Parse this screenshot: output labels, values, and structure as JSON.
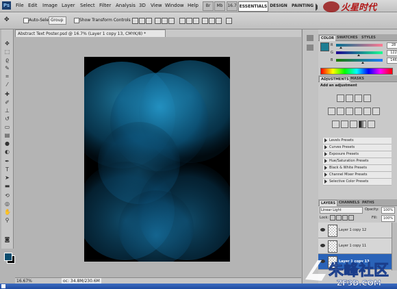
{
  "app": {
    "logo": "Ps",
    "menu": [
      "File",
      "Edit",
      "Image",
      "Layer",
      "Select",
      "Filter",
      "Analysis",
      "3D",
      "View",
      "Window",
      "Help"
    ],
    "zoom": "16.7",
    "workspaces": [
      "ESSENTIALS",
      "DESIGN",
      "PAINTING"
    ],
    "watermark_top": "火星时代"
  },
  "options": {
    "auto_select_label": "Auto-Select:",
    "auto_select_value": "Group",
    "show_transform_label": "Show Transform Controls"
  },
  "document": {
    "tab_title": "Abstract Text Poster.psd @ 16.7% (Layer 1 copy 13, CMYK/8) *"
  },
  "status": {
    "zoom": "16.67%",
    "doc_size": "oc: 34.8M/230.6M"
  },
  "color_panel": {
    "tabs": [
      "COLOR",
      "SWATCHES",
      "STYLES"
    ],
    "channels": [
      {
        "label": "R",
        "value": "28",
        "frac": 0.11
      },
      {
        "label": "G",
        "value": "122",
        "frac": 0.48
      },
      {
        "label": "B",
        "value": "146",
        "frac": 0.57
      }
    ]
  },
  "adjustments_panel": {
    "tabs": [
      "ADJUSTMENTS",
      "MASKS"
    ],
    "heading": "Add an adjustment",
    "presets": [
      "Levels Presets",
      "Curves Presets",
      "Exposure Presets",
      "Hue/Saturation Presets",
      "Black & White Presets",
      "Channel Mixer Presets",
      "Selective Color Presets"
    ]
  },
  "layers_panel": {
    "tabs": [
      "LAYERS",
      "CHANNELS",
      "PATHS"
    ],
    "blend_mode": "Linear Light",
    "opacity_label": "Opacity:",
    "opacity": "100%",
    "lock_label": "Lock:",
    "fill_label": "Fill:",
    "fill": "100%",
    "layers": [
      {
        "name": "Layer 1 copy 12",
        "selected": false
      },
      {
        "name": "Layer 1 copy 11",
        "selected": false
      },
      {
        "name": "Layer 1 copy 13",
        "selected": true
      }
    ]
  },
  "watermark_bottom": "朱峰社区",
  "watermark_bottom_sub": "ZF3D.COM",
  "colors": {
    "foreground": "#0b4d6e",
    "background": "#000000",
    "accent": "#2a63b8",
    "artwork_blue": "#1e8cc4"
  }
}
